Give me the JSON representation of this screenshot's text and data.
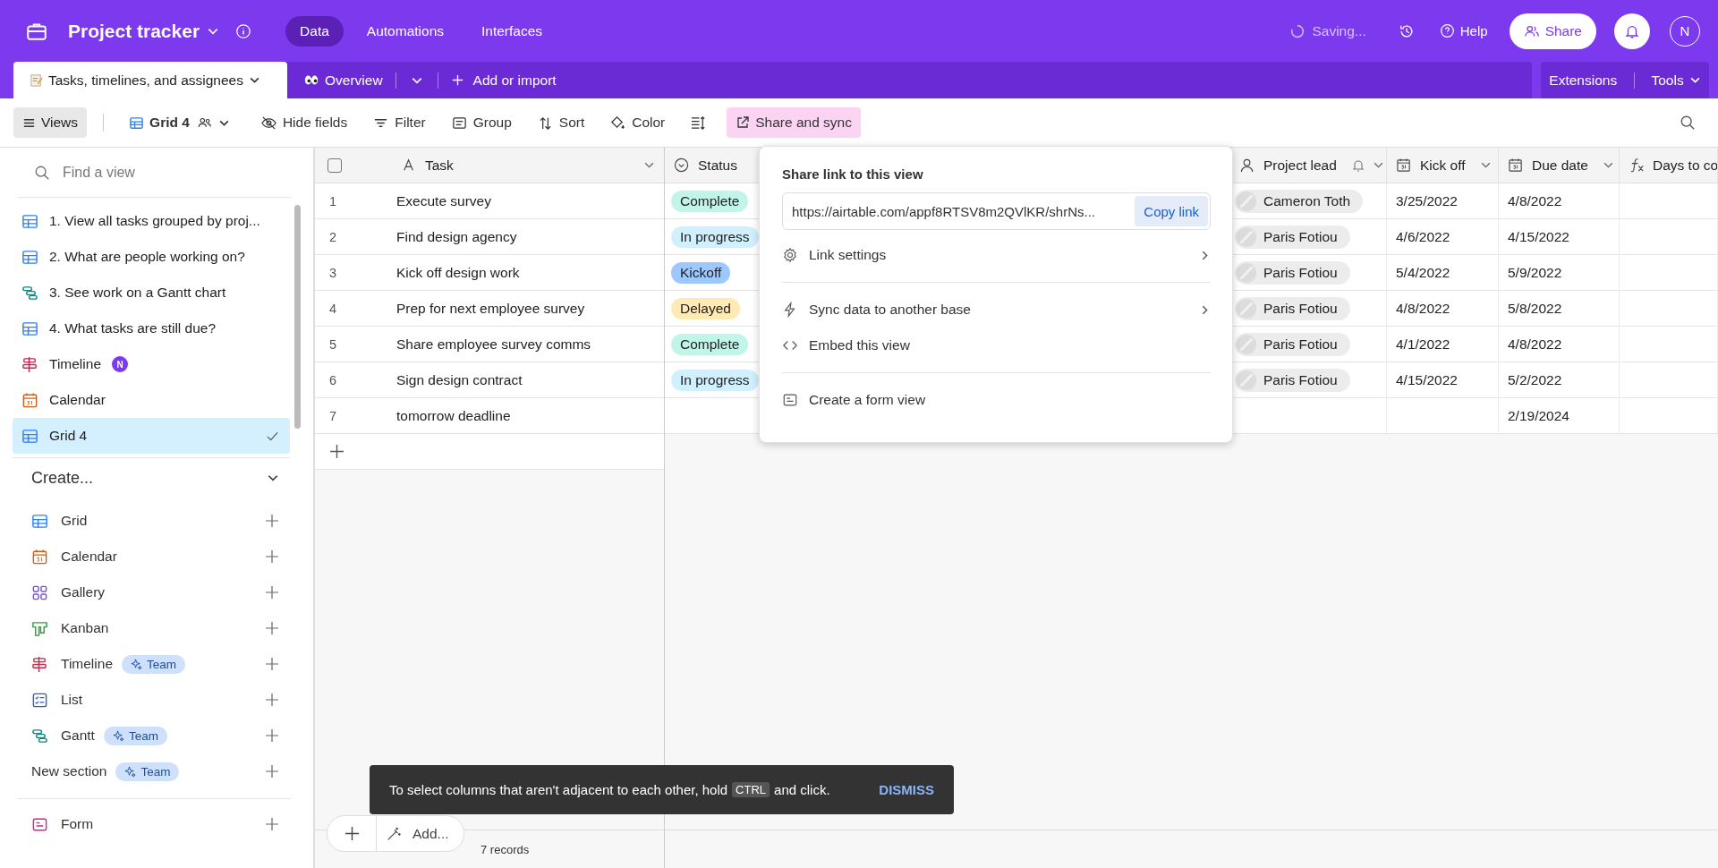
{
  "topbar": {
    "title": "Project tracker",
    "nav": [
      {
        "label": "Data",
        "selected": true
      },
      {
        "label": "Automations",
        "selected": false
      },
      {
        "label": "Interfaces",
        "selected": false
      }
    ],
    "status": "Saving...",
    "help": "Help",
    "share": "Share",
    "avatar": "N"
  },
  "tabs": [
    {
      "label": "Tasks, timelines, and assignees",
      "selected": true,
      "kind": "memo"
    },
    {
      "label": "Overview",
      "selected": false,
      "kind": "eyes"
    }
  ],
  "add_import": "Add or import",
  "extensions": "Extensions",
  "tools": "Tools",
  "toolbar": {
    "views": "Views",
    "view_name": "Grid 4",
    "buttons": [
      {
        "label": "Hide fields",
        "kind": "hide"
      },
      {
        "label": "Filter",
        "kind": "filter"
      },
      {
        "label": "Group",
        "kind": "group"
      },
      {
        "label": "Sort",
        "kind": "sort"
      },
      {
        "label": "Color",
        "kind": "color"
      },
      {
        "kind": "row_height"
      }
    ],
    "share_sync": "Share and sync"
  },
  "sidebar": {
    "search_placeholder": "Find a view",
    "views": [
      {
        "label": "1. View all tasks grouped by proj...",
        "kind": "grid",
        "selected": false
      },
      {
        "label": "2. What are people working on?",
        "kind": "grid",
        "selected": false
      },
      {
        "label": "3. See work on a Gantt chart",
        "kind": "gantt",
        "selected": false
      },
      {
        "label": "4. What tasks are still due?",
        "kind": "grid",
        "selected": false
      },
      {
        "label": "Timeline",
        "kind": "timeline",
        "selected": false,
        "badge": "N"
      },
      {
        "label": "Calendar",
        "kind": "calendar",
        "selected": false
      },
      {
        "label": "Grid 4",
        "kind": "grid",
        "selected": true
      }
    ],
    "create_title": "Create...",
    "create_items": [
      {
        "label": "Grid",
        "kind": "grid"
      },
      {
        "label": "Calendar",
        "kind": "calendar"
      },
      {
        "label": "Gallery",
        "kind": "gallery"
      },
      {
        "label": "Kanban",
        "kind": "kanban"
      },
      {
        "label": "Timeline",
        "kind": "timeline",
        "badge": "Team"
      },
      {
        "label": "List",
        "kind": "list"
      },
      {
        "label": "Gantt",
        "kind": "gantt",
        "badge": "Team"
      }
    ],
    "new_section": {
      "label": "New section",
      "badge": "Team"
    },
    "form": {
      "label": "Form",
      "kind": "form"
    }
  },
  "table": {
    "select_all": {
      "checked": false
    },
    "columns": [
      {
        "label": "Task",
        "kind": "text"
      },
      {
        "label": "Status",
        "kind": "status"
      },
      {
        "label": "Project lead",
        "kind": "user"
      },
      {
        "label": "Kick off",
        "kind": "date"
      },
      {
        "label": "Due date",
        "kind": "date"
      },
      {
        "label": "Days to co",
        "kind": "formula"
      }
    ],
    "rows": [
      {
        "num": "1",
        "task": "Execute survey",
        "status": {
          "label": "Complete",
          "color": "#c2f5e9"
        },
        "lead": "Cameron Toth",
        "kickoff": "3/25/2022",
        "due": "4/8/2022"
      },
      {
        "num": "2",
        "task": "Find design agency",
        "status": {
          "label": "In progress",
          "color": "#d0f0fd"
        },
        "lead": "Paris Fotiou",
        "kickoff": "4/6/2022",
        "due": "4/15/2022"
      },
      {
        "num": "3",
        "task": "Kick off design work",
        "status": {
          "label": "Kickoff",
          "color": "#9cc7ff"
        },
        "lead": "Paris Fotiou",
        "kickoff": "5/4/2022",
        "due": "5/9/2022"
      },
      {
        "num": "4",
        "task": "Prep for next employee survey",
        "status": {
          "label": "Delayed",
          "color": "#ffeab6"
        },
        "lead": "Paris Fotiou",
        "kickoff": "4/8/2022",
        "due": "5/8/2022"
      },
      {
        "num": "5",
        "task": "Share employee survey comms",
        "status": {
          "label": "Complete",
          "color": "#c2f5e9"
        },
        "lead": "Paris Fotiou",
        "kickoff": "4/1/2022",
        "due": "4/8/2022"
      },
      {
        "num": "6",
        "task": "Sign design contract",
        "status": {
          "label": "In progress",
          "color": "#d0f0fd"
        },
        "lead": "Paris Fotiou",
        "kickoff": "4/15/2022",
        "due": "5/2/2022"
      },
      {
        "num": "7",
        "task": "tomorrow deadline",
        "due": "2/19/2024"
      }
    ],
    "records": "7 records",
    "add_label": "Add..."
  },
  "popup": {
    "title": "Share link to this view",
    "url": "https://airtable.com/appf8RTSV8m2QVlKR/shrNs...",
    "copy": "Copy link",
    "items": [
      {
        "label": "Link settings",
        "kind": "gear",
        "submenu": true
      },
      {
        "label": "Sync data to another base",
        "kind": "bolt",
        "submenu": true
      },
      {
        "label": "Embed this view",
        "kind": "code",
        "submenu": false
      },
      {
        "label": "Create a form view",
        "kind": "form",
        "submenu": false
      }
    ]
  },
  "toast": {
    "before": "To select columns that aren't adjacent to each other, hold",
    "key": "CTRL",
    "after": "and click.",
    "action": "DISMISS"
  }
}
